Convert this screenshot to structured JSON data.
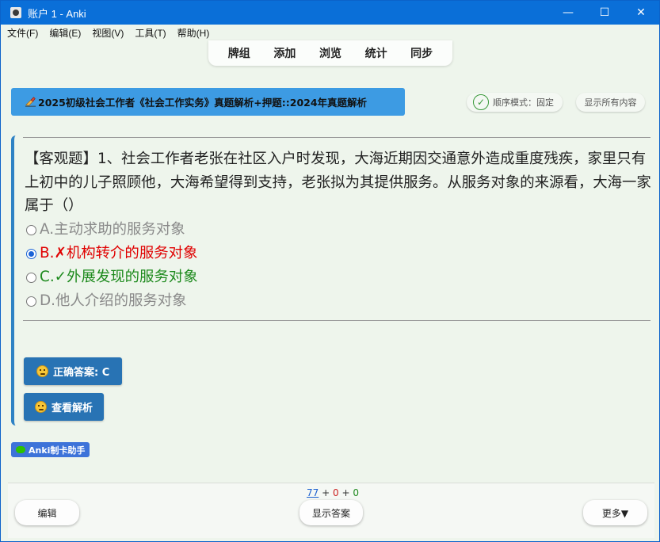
{
  "window": {
    "title": "账户 1 - Anki",
    "minimize": "—",
    "maximize": "☐",
    "close": "✕"
  },
  "menu": [
    "文件(F)",
    "编辑(E)",
    "视图(V)",
    "工具(T)",
    "帮助(H)"
  ],
  "toolbar": [
    "牌组",
    "添加",
    "浏览",
    "统计",
    "同步"
  ],
  "deck": {
    "icon": "writing-hand-icon",
    "name": "2025初级社会工作者《社会工作实务》真题解析+押题::2024年真题解析"
  },
  "controls": {
    "order_mode": "顺序模式：固定",
    "show_all": "显示所有内容"
  },
  "question": {
    "text": "【客观题】1、社会工作者老张在社区入户时发现，大海近期因交通意外造成重度残疾，家里只有上初中的儿子照顾他，大海希望得到支持，老张拟为其提供服务。从服务对象的来源看，大海一家属于（）",
    "options": [
      {
        "label": "A.主动求助的服务对象",
        "state": "unselected"
      },
      {
        "label": "B.✗机构转介的服务对象",
        "state": "selected-wrong"
      },
      {
        "label": "C.✓外展发现的服务对象",
        "state": "correct"
      },
      {
        "label": "D.他人介绍的服务对象",
        "state": "unselected"
      }
    ]
  },
  "buttons": {
    "correct_answer": "正确答案: C",
    "view_analysis": "查看解析",
    "helper": "Anki制卡助手"
  },
  "counts": {
    "new": "77",
    "plus1": "+",
    "learn": "0",
    "plus2": "+",
    "review": "0"
  },
  "bottom": {
    "edit": "编辑",
    "show_answer": "显示答案",
    "more": "更多▼"
  },
  "colors": {
    "titlebar": "#0a6fd8",
    "deck_banner": "#3d9be3",
    "wrong": "#e00000",
    "correct": "#1d8a1d",
    "button": "#2873b4"
  }
}
